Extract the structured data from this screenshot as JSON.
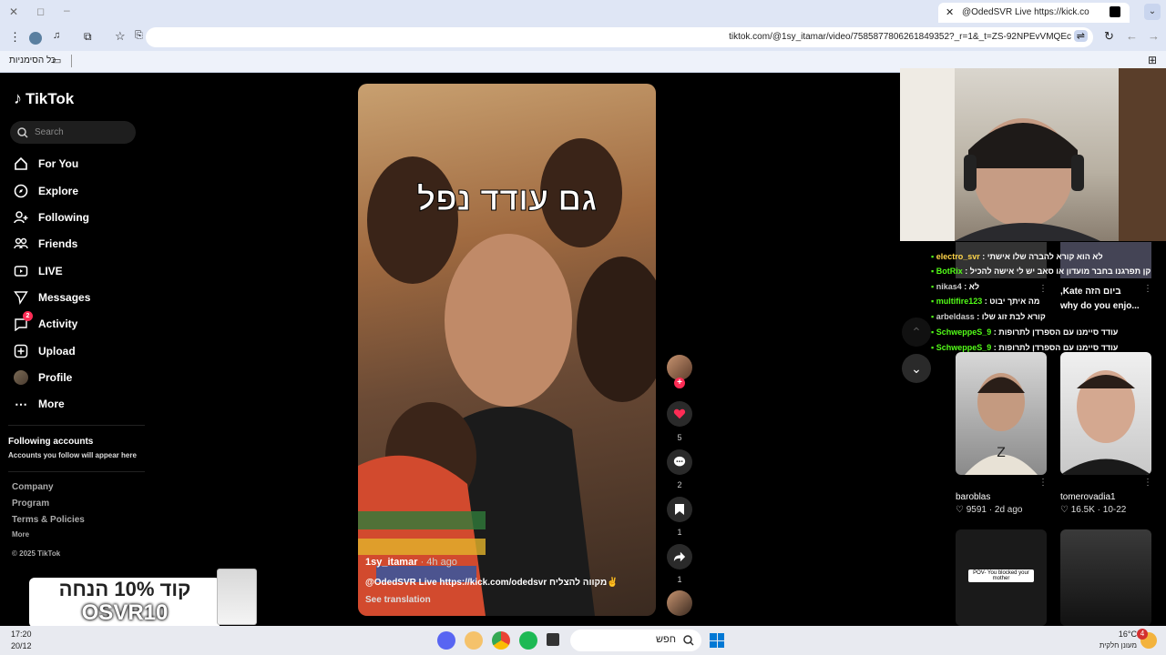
{
  "browser": {
    "tab_title": "@OdedSVR Live https://kick.co",
    "url": "tiktok.com/@1sy_itamar/video/7585877806261849352?_r=1&_t=ZS-92NPEvVMQEc",
    "bookmarks_label": "כל הסימניות"
  },
  "sidebar": {
    "logo": "TikTok",
    "search_placeholder": "Search",
    "items": [
      {
        "label": "For You"
      },
      {
        "label": "Explore"
      },
      {
        "label": "Following"
      },
      {
        "label": "Friends"
      },
      {
        "label": "LIVE"
      },
      {
        "label": "Messages"
      },
      {
        "label": "Activity"
      },
      {
        "label": "Upload"
      },
      {
        "label": "Profile"
      },
      {
        "label": "More"
      }
    ],
    "activity_badge": "2",
    "following_title": "Following accounts",
    "following_sub": "Accounts you follow will appear here",
    "footer": [
      "Company",
      "Program",
      "Terms & Policies",
      "More"
    ],
    "copyright": "© 2025 TikTok"
  },
  "video": {
    "overlay_text": "גם עודד נפל",
    "author": "1sy_itamar",
    "time_ago": "· 4h ago",
    "caption": "@OdedSVR Live  https://kick.com/odedsvr מקווה להצליח✌",
    "see_translation": "See translation"
  },
  "actions": {
    "likes": "5",
    "comments": "2",
    "saves": "1",
    "shares": "1"
  },
  "stream": {
    "chat": [
      {
        "user": "electro_svr",
        "msg": "לא הוא קורא להברה שלו אישתי"
      },
      {
        "user": "BotRix",
        "msg": "קן תפרגנו בחבר מועדון או סאב יש לי אישה להכיל"
      },
      {
        "user": "nikas4",
        "msg": "לא"
      },
      {
        "user": "multifire123",
        "msg": "מה איתך יבוט"
      },
      {
        "user": "arbeldass",
        "msg": "קורא לבת זוג שלו"
      },
      {
        "user": "SchweppeS_9",
        "msg": "עודד סיימנו עם הספרדן לתרופות"
      },
      {
        "user": "SchweppeS_9",
        "msg": "עודד סיימנו עם הספרדן לתרופות"
      }
    ],
    "promo_code_line": "קוד 10% הנחה",
    "promo_code": "OSVR10"
  },
  "suggested": [
    {
      "name": "baroblas",
      "likes": "9591",
      "date": "2d ago"
    },
    {
      "name": "tomerovadia1",
      "likes": "16.5K",
      "date": "10-22"
    }
  ],
  "suggested_text": {
    "card2_caption": "why do you enjo...",
    "card2_prefix": "ביום הזה Kate,",
    "blocked_text": "POV- You blocked your mother"
  },
  "taskbar": {
    "search": "חפש",
    "time": "17:20",
    "date": "20/12",
    "weather_temp": "16°C",
    "weather_desc": "מעונן חלקית",
    "notif": "4"
  }
}
